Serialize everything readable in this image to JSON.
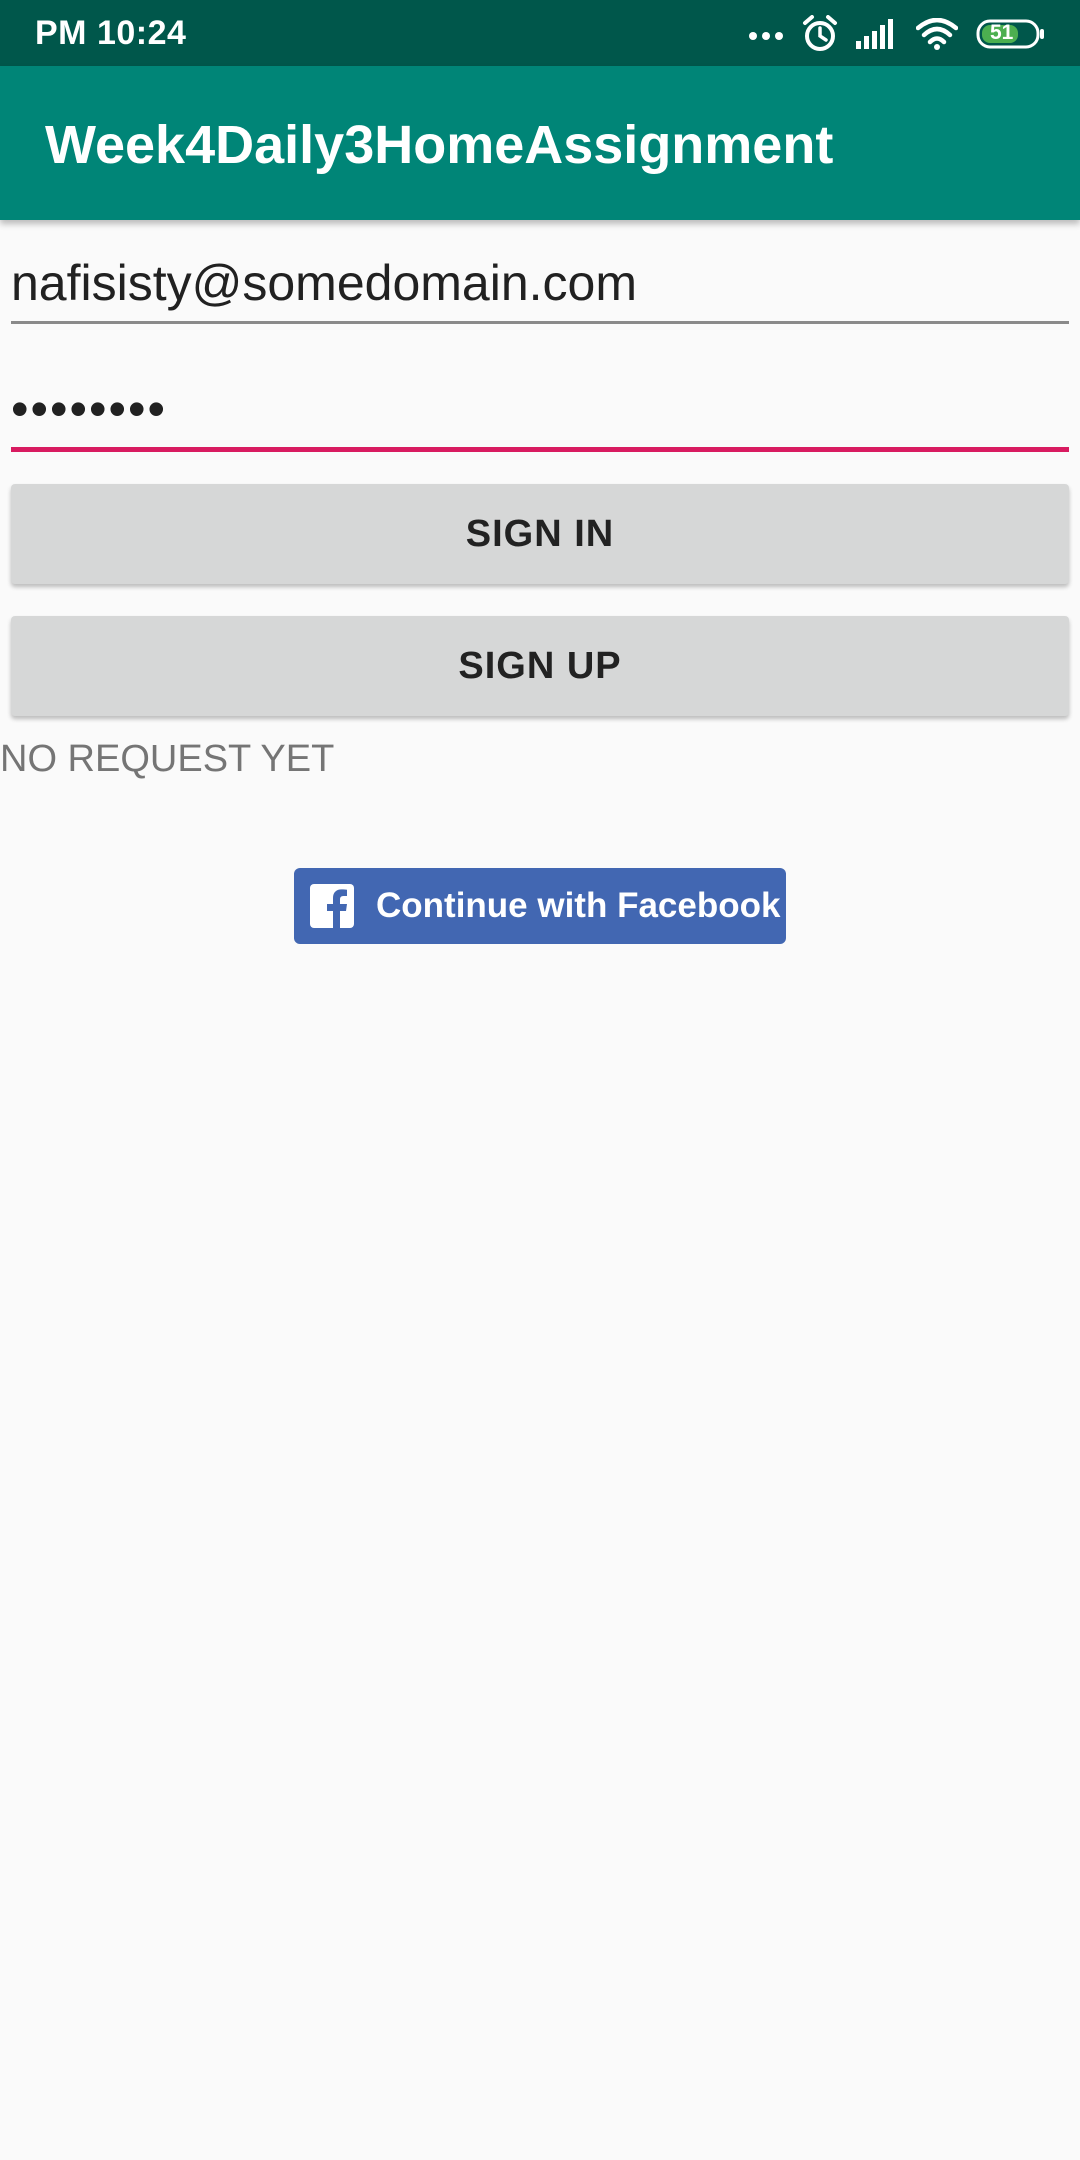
{
  "status_bar": {
    "time": "PM 10:24",
    "battery_level": "51",
    "icons": [
      "more-dots-icon",
      "alarm-icon",
      "signal-icon",
      "wifi-icon",
      "battery-icon"
    ]
  },
  "app_bar": {
    "title": "Week4Daily3HomeAssignment",
    "color": "#008577",
    "status_color": "#00574b"
  },
  "form": {
    "email_value": "nafisisty@somedomain.com",
    "password_value": "••••••••",
    "accent_color": "#d81b60"
  },
  "buttons": {
    "sign_in_label": "SIGN IN",
    "sign_up_label": "SIGN UP"
  },
  "status": {
    "request_text": "NO REQUEST YET"
  },
  "facebook": {
    "label": "Continue with Facebook",
    "icon": "facebook-icon",
    "color": "#4267b2"
  }
}
